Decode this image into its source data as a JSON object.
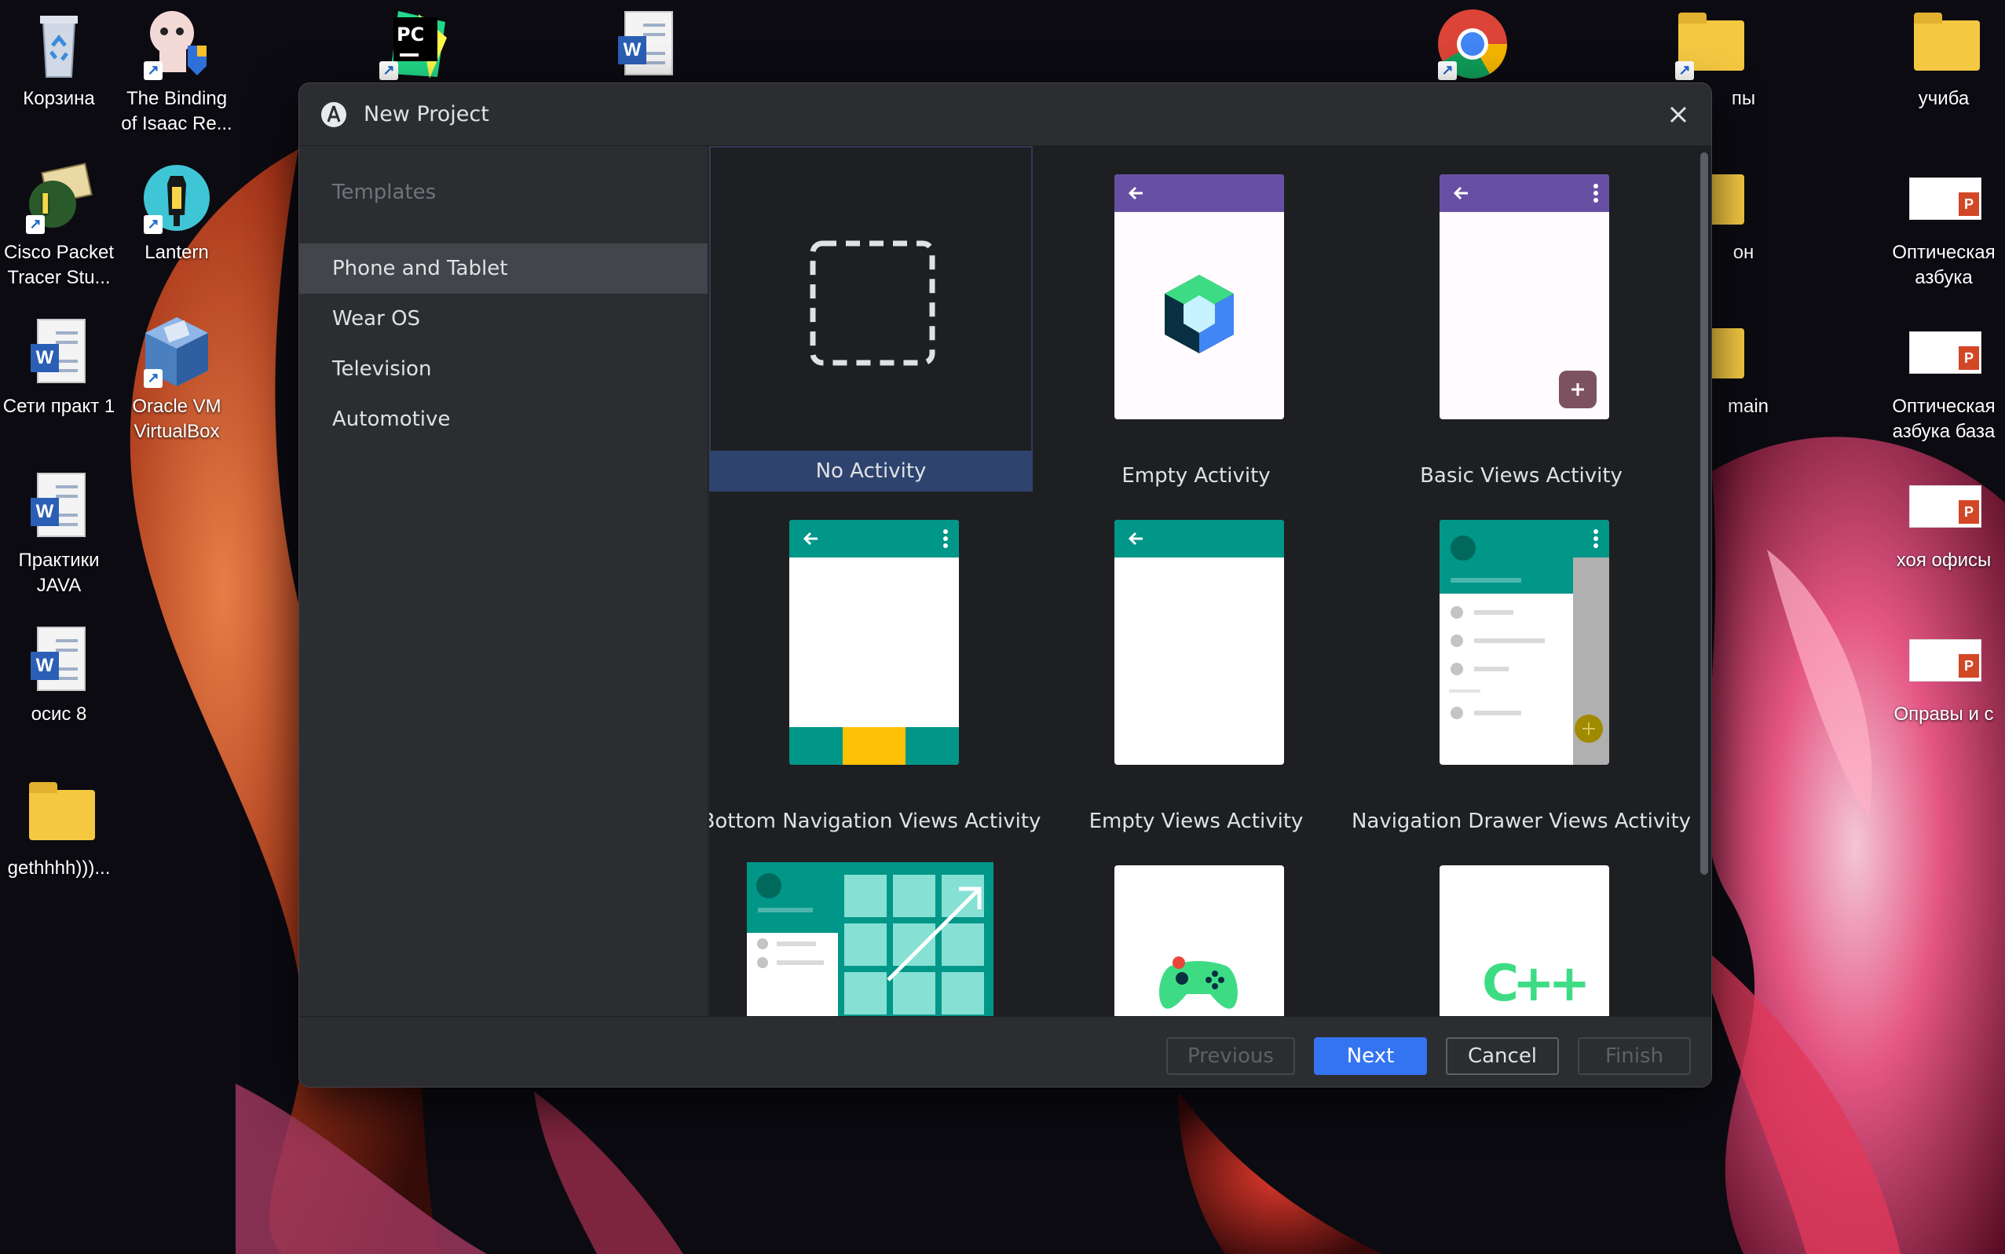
{
  "desktop": {
    "icons": [
      {
        "label": "Корзина"
      },
      {
        "label": "The Binding of Isaac Re..."
      },
      {
        "label": "PC"
      },
      {
        "label": "Cisco Packet Tracer Stu..."
      },
      {
        "label": "Lantern"
      },
      {
        "label": "Сети практ 1"
      },
      {
        "label": "Oracle VM VirtualBox"
      },
      {
        "label": "Практики JAVA"
      },
      {
        "label": "осис 8"
      },
      {
        "label": "gethhhh)))..."
      },
      {
        "label": "учиба"
      },
      {
        "label": "Оптическая азбука"
      },
      {
        "label": "Оптическая азбука база"
      },
      {
        "label": "хоя офисы"
      },
      {
        "label": "Оправы и с"
      },
      {
        "label": "пы"
      },
      {
        "label": "он"
      },
      {
        "label": "main"
      }
    ],
    "badges": {
      "word": "W",
      "ppt": "P",
      "shortcut": "↗"
    }
  },
  "dialog": {
    "title": "New Project",
    "sidebar": {
      "header": "Templates",
      "items": [
        {
          "label": "Phone and Tablet",
          "selected": true
        },
        {
          "label": "Wear OS",
          "selected": false
        },
        {
          "label": "Television",
          "selected": false
        },
        {
          "label": "Automotive",
          "selected": false
        }
      ]
    },
    "templates": [
      {
        "label": "No Activity",
        "selected": true
      },
      {
        "label": "Empty Activity"
      },
      {
        "label": "Basic Views Activity"
      },
      {
        "label": "Bottom Navigation Views Activity"
      },
      {
        "label": "Empty Views Activity"
      },
      {
        "label": "Navigation Drawer Views Activity"
      }
    ],
    "cpp_badge": "C++",
    "buttons": {
      "previous": "Previous",
      "next": "Next",
      "cancel": "Cancel",
      "finish": "Finish"
    }
  },
  "colors": {
    "accent": "#3574f0",
    "selection": "#2e436e",
    "purple_appbar": "#6750a4",
    "teal_appbar": "#009688",
    "nav_yellow": "#ffc107"
  }
}
